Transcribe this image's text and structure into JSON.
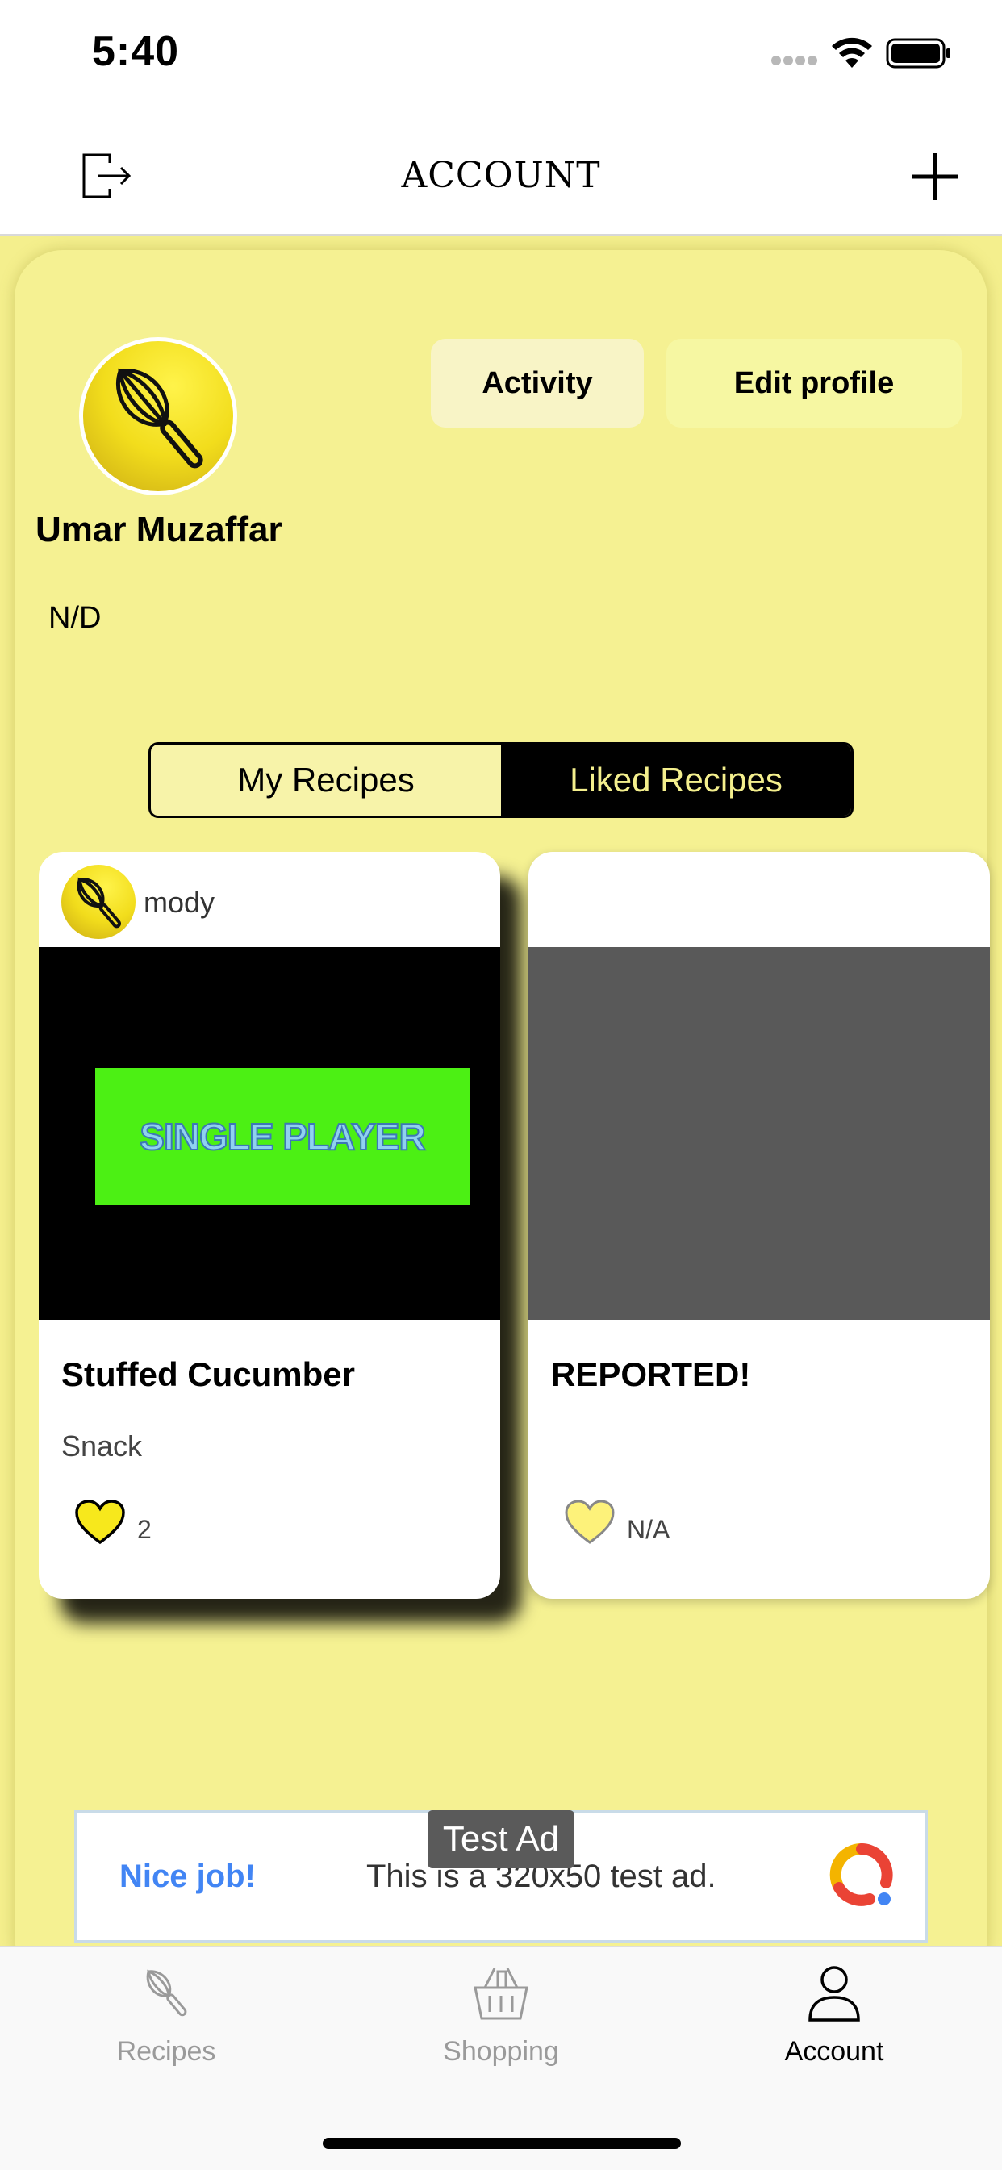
{
  "status_bar": {
    "time": "5:40"
  },
  "nav": {
    "title": "ACCOUNT"
  },
  "profile": {
    "name": "Umar Muzaffar",
    "bio": "N/D",
    "activity_label": "Activity",
    "edit_label": "Edit profile"
  },
  "segments": [
    {
      "label": "My Recipes",
      "selected": false
    },
    {
      "label": "Liked Recipes",
      "selected": true
    }
  ],
  "recipes": [
    {
      "author": "mody",
      "image_text": "SINGLE PLAYER",
      "title": "Stuffed Cucumber",
      "category": "Snack",
      "likes": "2"
    },
    {
      "author": "",
      "image_text": "",
      "title": "REPORTED!",
      "category": "",
      "likes": "N/A"
    }
  ],
  "ad": {
    "badge": "Test Ad",
    "headline": "Nice job!",
    "text": "This is a 320x50 test ad."
  },
  "tabs": [
    {
      "label": "Recipes",
      "icon": "whisk-icon",
      "active": false
    },
    {
      "label": "Shopping",
      "icon": "basket-icon",
      "active": false
    },
    {
      "label": "Account",
      "icon": "person-icon",
      "active": true
    }
  ],
  "colors": {
    "background": "#f4ef8d",
    "active_segment": "#000000",
    "heart": "#f7e81c",
    "ad_headline": "#4285f4"
  }
}
